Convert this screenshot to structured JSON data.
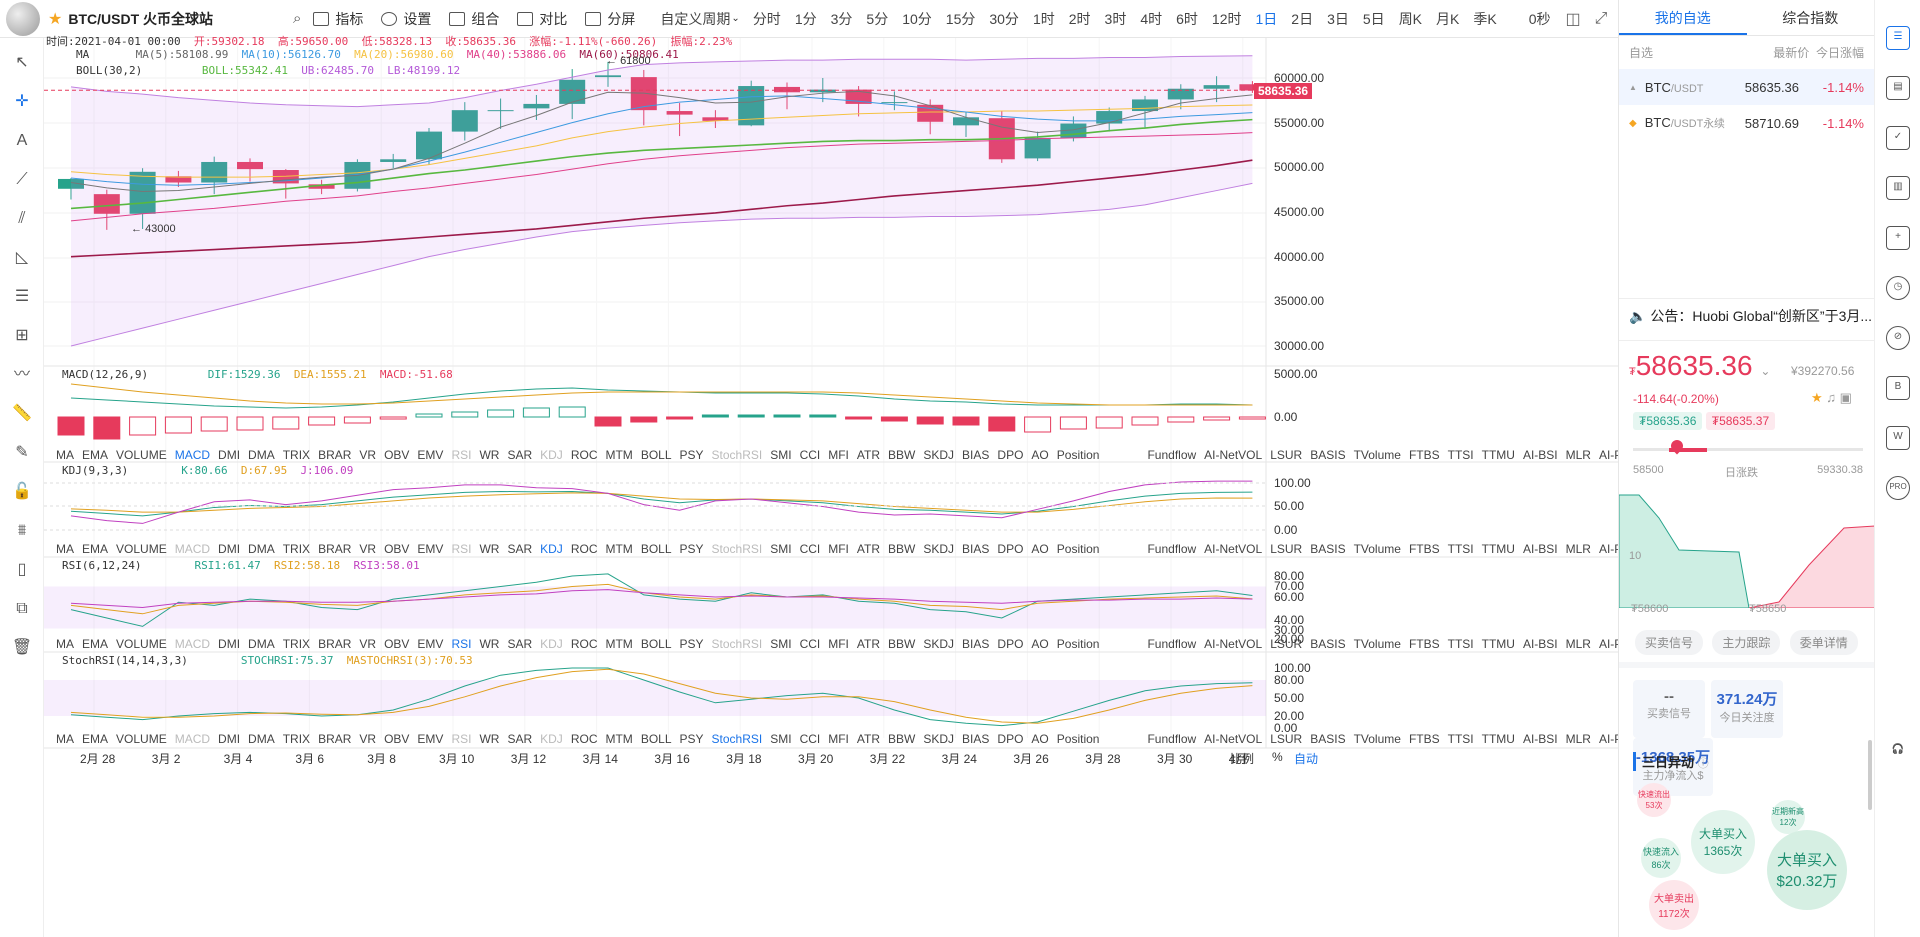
{
  "header": {
    "symbol": "BTC/USDT 火币全球站",
    "tools": [
      "指标",
      "设置",
      "组合",
      "对比",
      "分屏"
    ],
    "custom_period": "自定义周期",
    "periods": [
      "分时",
      "1分",
      "3分",
      "5分",
      "10分",
      "15分",
      "30分",
      "1时",
      "2时",
      "3时",
      "4时",
      "6时",
      "12时",
      "1日",
      "2日",
      "3日",
      "5日",
      "周K",
      "月K",
      "季K"
    ],
    "active_period": "1日",
    "seconds": "0秒"
  },
  "ohlc": {
    "time": "时间:2021-04-01 00:00",
    "open": "开:59302.18",
    "high": "高:59650.00",
    "low": "低:58328.13",
    "close": "收:58635.36",
    "chg": "涨幅:-1.11%(-660.26)",
    "amp": "振幅:2.23%"
  },
  "ma_legend": {
    "name": "MA",
    "ma5": "MA(5):58108.99",
    "ma10": "MA(10):56126.70",
    "ma20": "MA(20):56980.60",
    "ma40": "MA(40):53886.06",
    "ma60": "MA(60):50806.41"
  },
  "boll_legend": {
    "name": "BOLL(30,2)",
    "boll": "BOLL:55342.41",
    "ub": "UB:62485.70",
    "lb": "LB:48199.12"
  },
  "macd_legend": {
    "name": "MACD(12,26,9)",
    "dif": "DIF:1529.36",
    "dea": "DEA:1555.21",
    "macd": "MACD:-51.68"
  },
  "kdj_legend": {
    "name": "KDJ(9,3,3)",
    "k": "K:80.66",
    "d": "D:67.95",
    "j": "J:106.09"
  },
  "rsi_legend": {
    "name": "RSI(6,12,24)",
    "r1": "RSI1:61.47",
    "r2": "RSI2:58.18",
    "r3": "RSI3:58.01"
  },
  "stoch_legend": {
    "name": "StochRSI(14,14,3,3)",
    "s1": "STOCHRSI:75.37",
    "s2": "MASTOCHRSI(3):70.53"
  },
  "indicators": [
    "MA",
    "EMA",
    "VOLUME",
    "MACD",
    "DMI",
    "DMA",
    "TRIX",
    "BRAR",
    "VR",
    "OBV",
    "EMV",
    "RSI",
    "WR",
    "SAR",
    "KDJ",
    "ROC",
    "MTM",
    "BOLL",
    "PSY",
    "StochRSI",
    "SMI",
    "CCI",
    "MFI",
    "ATR",
    "BBW",
    "SKDJ",
    "BIAS",
    "DPO",
    "AO",
    "Position",
    "Fundflow",
    "AI-NetVOL",
    "LSUR",
    "BASIS",
    "TVolume",
    "FTBS",
    "TTSI",
    "TTMU",
    "AI-BSI",
    "MLR",
    "AI-PD"
  ],
  "price_axis": [
    "60000.00",
    "55000.00",
    "50000.00",
    "45000.00",
    "40000.00",
    "35000.00",
    "30000.00"
  ],
  "current_price_tag": "58635.36",
  "high_mark": "61800",
  "low_mark": "43000",
  "macd_axis": [
    "5000.00",
    "0.00"
  ],
  "kdj_axis": [
    "100.00",
    "50.00",
    "0.00"
  ],
  "rsi_axis": [
    "80.00",
    "70.00",
    "60.00",
    "40.00",
    "30.00",
    "20.00"
  ],
  "stoch_axis": [
    "100.00",
    "80.00",
    "50.00",
    "20.00",
    "0.00"
  ],
  "date_axis": [
    "2月 28",
    "3月 2",
    "3月 4",
    "3月 6",
    "3月 8",
    "3月 10",
    "3月 12",
    "3月 14",
    "3月 16",
    "3月 18",
    "3月 20",
    "3月 22",
    "3月 24",
    "3月 26",
    "3月 28",
    "3月 30",
    "4月"
  ],
  "bottom": {
    "ratio": "比例",
    "pct": "%",
    "auto": "自动"
  },
  "right": {
    "tabs": [
      "我的自选",
      "综合指数"
    ],
    "head": [
      "自选",
      "最新价",
      "今日涨幅"
    ],
    "rows": [
      {
        "name": "BTC",
        "quote": "/USDT",
        "price": "58635.36",
        "chg": "-1.14%"
      },
      {
        "name": "BTC",
        "quote": "/USDT永续",
        "price": "58710.69",
        "chg": "-1.14%"
      }
    ],
    "notice": "公告：Huobi Global“创新区”于3月...",
    "price": "58635.36",
    "cny": "¥392270.56",
    "chg": "-114.64(-0.20%)",
    "bid": "₮58635.36",
    "ask": "₮58635.37",
    "range_low": "58500",
    "range_label": "日涨跌",
    "range_high": "59330.38",
    "depth_left": "₮58600",
    "depth_right": "₮58650",
    "depth_mark": "10",
    "tags": [
      "买卖信号",
      "主力跟踪",
      "委单详情"
    ],
    "stats": [
      {
        "v": "--",
        "l": "买卖信号"
      },
      {
        "v": "371.24万",
        "l": "今日关注度"
      },
      {
        "v": "-1368.35万",
        "l": "主力净流入$"
      }
    ],
    "abn_title": "三日异动",
    "bubbles": [
      {
        "t": "快速流出",
        "s": "53次"
      },
      {
        "t": "大单买入",
        "s": "1365次"
      },
      {
        "t": "近期新高",
        "s": "12次"
      },
      {
        "t": "快速流入",
        "s": "86次"
      },
      {
        "t": "大单买入",
        "s": "$20.32万"
      },
      {
        "t": "大单卖出",
        "s": "1172次"
      }
    ]
  },
  "colors": {
    "up": "#26a38b",
    "down": "#e63a5c",
    "accent": "#1a73e8"
  }
}
